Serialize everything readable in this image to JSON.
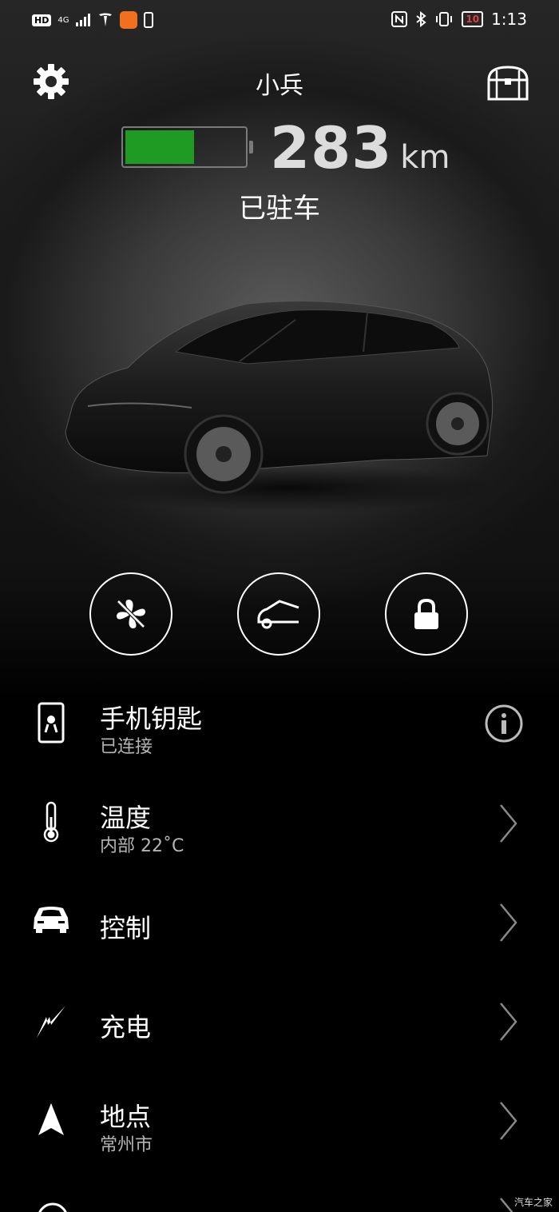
{
  "status_bar": {
    "hd": "HD",
    "net": "4G",
    "battery": "10",
    "time": "1:13"
  },
  "header": {
    "title": "小兵"
  },
  "battery": {
    "level": 0.58,
    "range_value": "283",
    "range_unit": "km",
    "state": "已驻车",
    "fill_color": "#1f9a22"
  },
  "quick_actions": [
    {
      "name": "fan",
      "icon": "fan-off-icon"
    },
    {
      "name": "frunk",
      "icon": "frunk-icon"
    },
    {
      "name": "lock",
      "icon": "lock-icon"
    }
  ],
  "menu": {
    "phone_key": {
      "label": "手机钥匙",
      "sub": "已连接",
      "icon": "phone-key-icon"
    },
    "climate": {
      "label": "温度",
      "sub": "内部 22˚C",
      "icon": "thermometer-icon"
    },
    "controls": {
      "label": "控制",
      "icon": "car-front-icon"
    },
    "charging": {
      "label": "充电",
      "icon": "lightning-icon"
    },
    "location": {
      "label": "地点",
      "sub": "常州市",
      "icon": "navigation-arrow-icon"
    }
  },
  "watermark": "汽车之家"
}
